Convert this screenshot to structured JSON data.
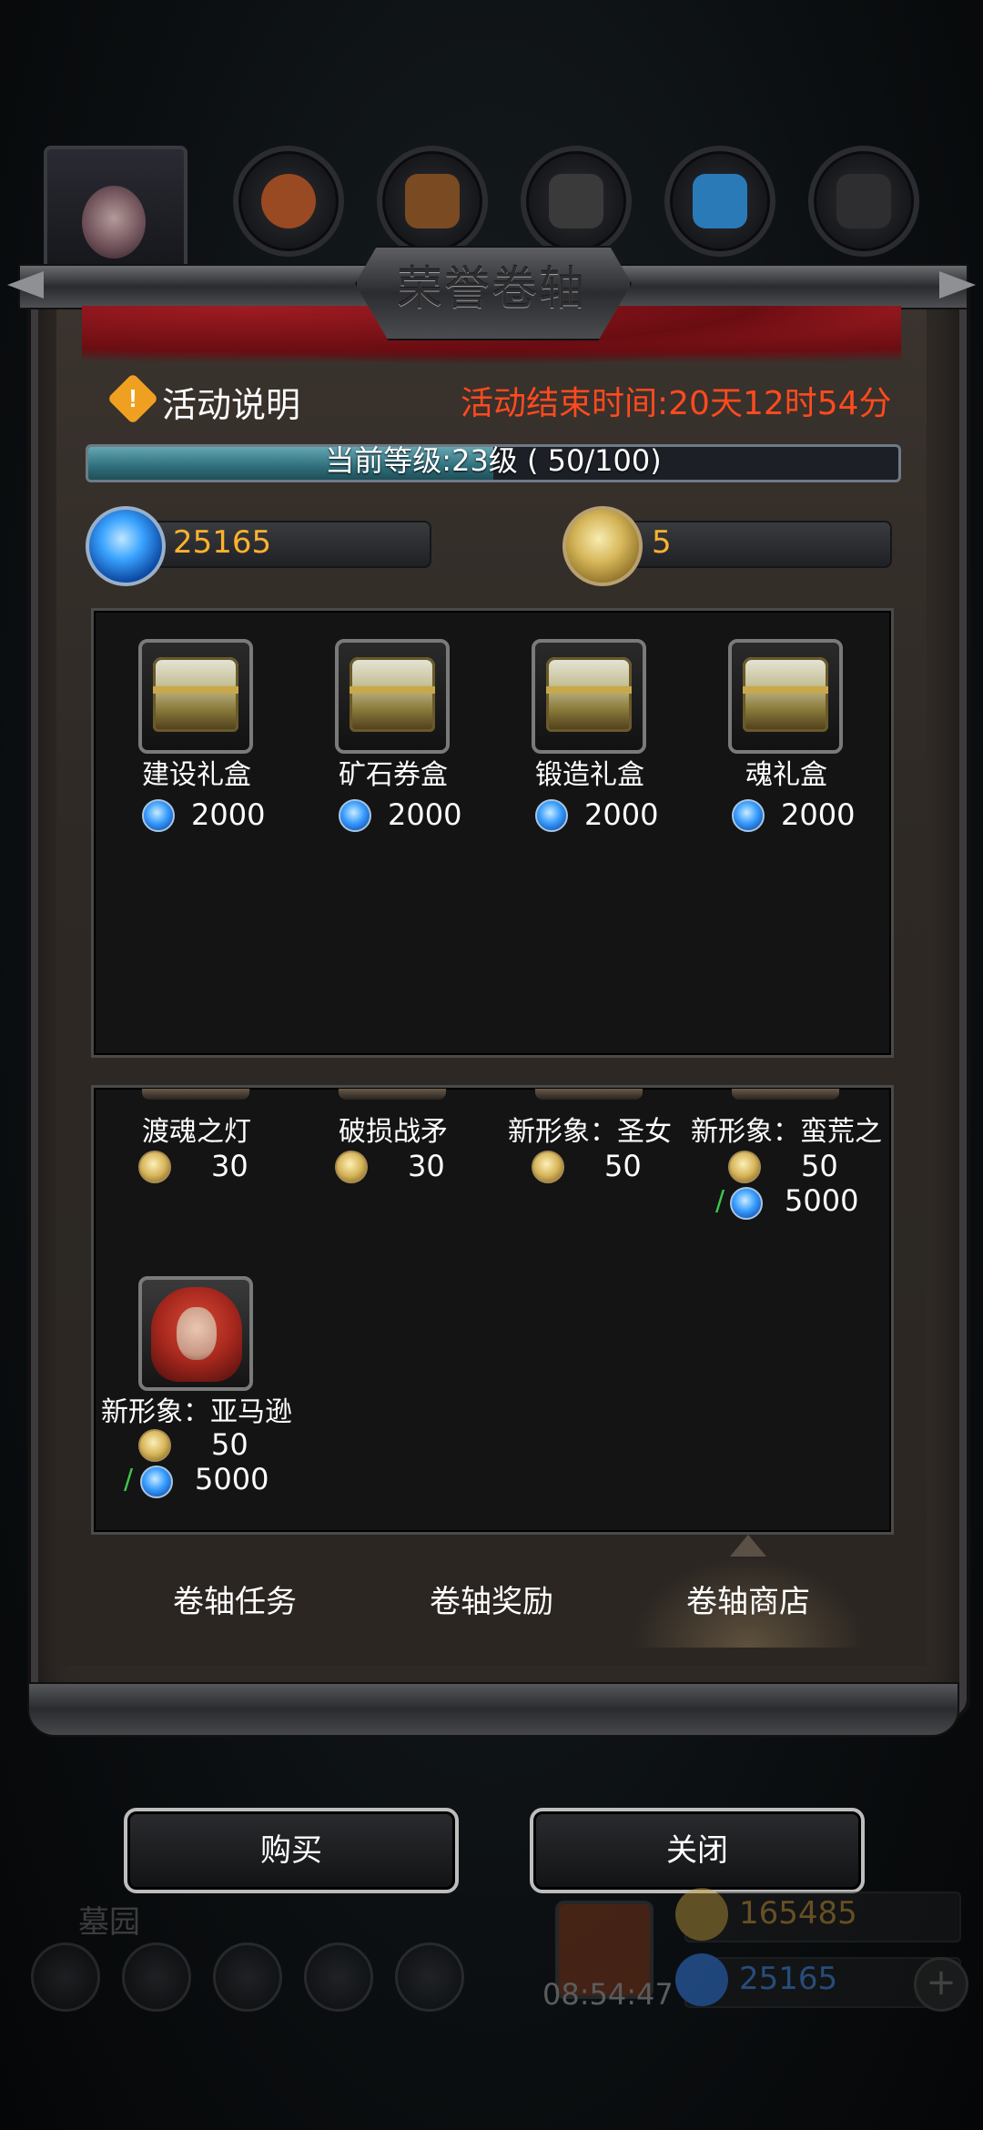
{
  "title": "荣誉卷轴",
  "activity": {
    "info_label": "活动说明",
    "end_time": "活动结束时间:20天12时54分"
  },
  "level": {
    "text": "当前等级:23级 ( 50/100)",
    "progress": 0.5
  },
  "currency": {
    "gems": "25165",
    "coins": "5"
  },
  "reward_boxes": [
    {
      "name": "建设礼盒",
      "price": "2000"
    },
    {
      "name": "矿石券盒",
      "price": "2000"
    },
    {
      "name": "锻造礼盒",
      "price": "2000"
    },
    {
      "name": "魂礼盒",
      "price": "2000"
    }
  ],
  "shop_items": [
    {
      "name": "渡魂之灯",
      "coin_price": "30"
    },
    {
      "name": "破损战矛",
      "coin_price": "30"
    },
    {
      "name": "新形象：圣女",
      "coin_price": "50"
    },
    {
      "name": "新形象：蛮荒之",
      "coin_price": "50",
      "alt_slash": "/",
      "gem_price": "5000"
    },
    {
      "name": "新形象：亚马逊",
      "coin_price": "50",
      "alt_slash": "/",
      "gem_price": "5000"
    }
  ],
  "tabs": [
    {
      "label": "卷轴任务",
      "active": false
    },
    {
      "label": "卷轴奖励",
      "active": false
    },
    {
      "label": "卷轴商店",
      "active": true
    }
  ],
  "buttons": {
    "buy": "购买",
    "close": "关闭"
  },
  "hud": {
    "location": "墓园",
    "timer": "08:54:47",
    "gold": "165485",
    "gems": "25165"
  },
  "colors": {
    "end_time": "#ff4a1e",
    "currency_value": "#ffb22e",
    "progress_fill": "#3a8a98"
  }
}
